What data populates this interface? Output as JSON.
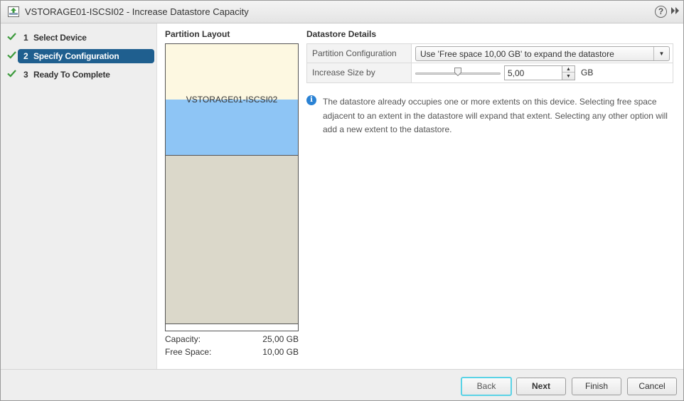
{
  "window": {
    "title": "VSTORAGE01-ISCSI02 - Increase Datastore Capacity",
    "icons": [
      "datastore-grow-icon",
      "help-icon",
      "popout-icon"
    ]
  },
  "nav": {
    "steps": [
      {
        "num": "1",
        "label": "Select Device",
        "completed": true,
        "active": false
      },
      {
        "num": "2",
        "label": "Specify Configuration",
        "completed": true,
        "active": true
      },
      {
        "num": "3",
        "label": "Ready To Complete",
        "completed": true,
        "active": false
      }
    ]
  },
  "partition_layout": {
    "title": "Partition Layout",
    "segment_label": "VSTORAGE01-ISCSI02",
    "capacity_label": "Capacity:",
    "capacity_value": "25,00 GB",
    "free_label": "Free Space:",
    "free_value": "10,00 GB"
  },
  "details": {
    "title": "Datastore Details",
    "partition_config_label": "Partition Configuration",
    "partition_config_value": "Use 'Free space 10,00 GB' to expand the datastore",
    "increase_label": "Increase Size by",
    "increase_value": "5,00",
    "increase_unit": "GB",
    "slider_fraction": 0.5,
    "info_text": "The datastore already occupies one or more extents on this device. Selecting free space adjacent to an extent in the datastore will expand that extent. Selecting any other option will add a new extent to the datastore."
  },
  "footer": {
    "back": "Back",
    "next": "Next",
    "finish": "Finish",
    "cancel": "Cancel"
  },
  "colors": {
    "active_step": "#1f5f8f",
    "check": "#3c9a3c",
    "used_segment": "#8ec5f5",
    "free_segment": "#fdf8e1",
    "other_segment": "#dbd8ca",
    "focus_ring": "#5ad3e6"
  }
}
